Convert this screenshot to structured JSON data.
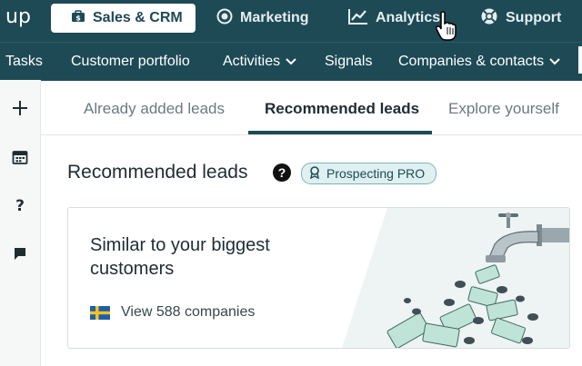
{
  "app": {
    "logo": "up"
  },
  "topnav": {
    "items": [
      {
        "label": "Sales & CRM",
        "icon": "briefcase-dollar-icon",
        "active": true
      },
      {
        "label": "Marketing",
        "icon": "target-icon"
      },
      {
        "label": "Analytics",
        "icon": "trend-chart-icon"
      },
      {
        "label": "Support",
        "icon": "lifebuoy-icon"
      }
    ]
  },
  "subnav": {
    "items": [
      {
        "label": "Tasks"
      },
      {
        "label": "Customer portfolio"
      },
      {
        "label": "Activities",
        "dropdown": true
      },
      {
        "label": "Signals"
      },
      {
        "label": "Companies & contacts",
        "dropdown": true
      }
    ]
  },
  "sidebar": {
    "icons": [
      "plus-icon",
      "calendar-icon",
      "question-icon",
      "chat-icon"
    ]
  },
  "tabs": [
    {
      "label": "Already added leads"
    },
    {
      "label": "Recommended leads",
      "active": true
    },
    {
      "label": "Explore yourself"
    }
  ],
  "main": {
    "title": "Recommended leads",
    "badge": "Prospecting PRO"
  },
  "card": {
    "title": "Similar to your biggest customers",
    "link": "View 588 companies",
    "flag": "sweden-flag"
  },
  "colors": {
    "navbar": "#1e4a55",
    "accent": "#1e4a55",
    "badge_bg": "#dff0f1",
    "card_bg": "#eef3f4"
  }
}
